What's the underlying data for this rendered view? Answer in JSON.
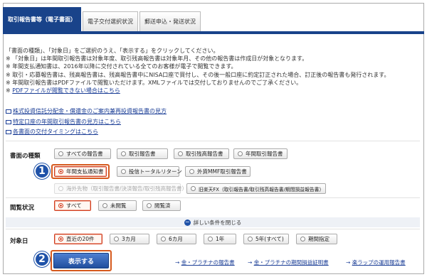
{
  "tabs": [
    {
      "label": "取引報告書等（電子書面）",
      "active": true
    },
    {
      "label": "電子交付選択状況",
      "active": false
    },
    {
      "label": "郵送申込・発送状況",
      "active": false
    }
  ],
  "info": {
    "lines": [
      "「書面の種類」、「対象日」をご選択のうえ、「表示する」をクリックしてください。",
      "※ 「対象日」は年間取引報告書は対象年度、取引残高報告書は対象年月、その他の報告書は作成日が対象となります。",
      "※ 年間支払通知書は、2016年以降に交付されている全てのお客様が電子で閲覧できます。",
      "※ 取引・応募報告書は、残高報告書は、残高報告書中にNISA口座で買付し、その後一般口座に約定訂正された場合、訂正後の報告書も発行されます。",
      "※ 年間取引報告書はPDFファイルで閲覧いただけます。XMLファイルでは交付しておりませんのでご了承ください。"
    ],
    "pdf_note_prefix": "※ ",
    "pdf_note_link": "PDFファイルが閲覧できない場合はこちら"
  },
  "links": [
    "株式投資信託分配金・償還金のご案内兼再投資報告書の見方",
    "特定口座の年間取引報告書の見方はこちら",
    "各書面の交付タイミングはこちら"
  ],
  "doc_type": {
    "label": "書面の種類",
    "row1": [
      "すべての報告書",
      "取引報告書",
      "取引残高報告書",
      "年間取引報告書"
    ],
    "row2": [
      "年間支払通知書",
      "投信トータルリターン",
      "外貨MMF取引報告書"
    ],
    "row3": [
      "海外先物（取引報告書/決済報告/取引残高報告書）",
      "旧楽天FX（取引報告書/取引残高報告書/期間損益報告書）"
    ],
    "selected": "年間支払通知書"
  },
  "status": {
    "label": "閲覧状況",
    "options": [
      "すべて",
      "未閲覧",
      "閲覧済"
    ],
    "selected": "すべて"
  },
  "detail_toggle": "詳しい条件を閉じる",
  "target_date": {
    "label": "対象日",
    "options": [
      "直近の20件",
      "3カ月",
      "6カ月",
      "1年",
      "5年(すべて)",
      "期間指定"
    ],
    "selected": "直近の20件"
  },
  "badges": {
    "one": "1",
    "two": "2"
  },
  "submit_label": "表示する",
  "footer_links": [
    {
      "arrow": "→",
      "text": "金・プラチナの報告書"
    },
    {
      "arrow": "→",
      "text": "金・プラチナの期間損益証明書"
    },
    {
      "arrow": "→",
      "text": "楽ラップの運用報告書"
    }
  ],
  "colors": {
    "primary": "#19438a",
    "highlight": "#d65a1e",
    "link": "#1a3d96"
  }
}
